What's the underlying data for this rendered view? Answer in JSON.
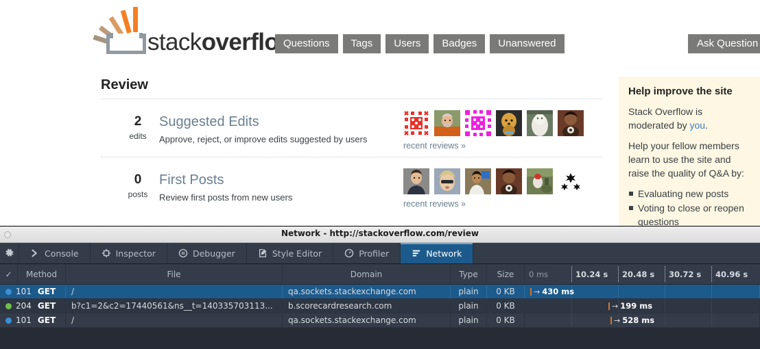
{
  "site": {
    "logo_light": "stack",
    "logo_bold": "overflow",
    "nav": [
      {
        "label": "Questions"
      },
      {
        "label": "Tags"
      },
      {
        "label": "Users"
      },
      {
        "label": "Badges"
      },
      {
        "label": "Unanswered"
      }
    ],
    "ask_button": "Ask Question"
  },
  "main": {
    "page_title": "Review",
    "queues": [
      {
        "count": "2",
        "unit": "edits",
        "title": "Suggested Edits",
        "description": "Approve, reject, or improve edits suggested by users",
        "recent_link": "recent reviews »",
        "avatars": [
          {
            "name": "identicon-red"
          },
          {
            "name": "photo-man-orange-shirt"
          },
          {
            "name": "identicon-magenta"
          },
          {
            "name": "photo-dog-pomeranian"
          },
          {
            "name": "photo-white-animal"
          },
          {
            "name": "photo-man-dark"
          }
        ]
      },
      {
        "count": "0",
        "unit": "posts",
        "title": "First Posts",
        "description": "Review first posts from new users",
        "recent_link": "recent reviews »",
        "avatars": [
          {
            "name": "photo-man-gray-bg"
          },
          {
            "name": "photo-person-sunglasses"
          },
          {
            "name": "photo-man-office"
          },
          {
            "name": "photo-man-dark-bg"
          },
          {
            "name": "photo-outdoor-scene"
          },
          {
            "name": "identicon-stars-black"
          }
        ]
      }
    ]
  },
  "sidebar": {
    "title": "Help improve the site",
    "paragraph1_before": "Stack Overflow is moderated by ",
    "paragraph1_link": "you",
    "paragraph1_after": ".",
    "paragraph2": "Help your fellow members learn to use the site and raise the quality of Q&A by:",
    "bullets": [
      "Evaluating new posts",
      "Voting to close or reopen questions"
    ]
  },
  "devtools": {
    "window_title": "Network - http://stackoverflow.com/review",
    "tabs": [
      {
        "label": "Console",
        "icon": "chevron-right-icon",
        "active": false
      },
      {
        "label": "Inspector",
        "icon": "inspector-box-icon",
        "active": false
      },
      {
        "label": "Debugger",
        "icon": "pause-circle-icon",
        "active": false
      },
      {
        "label": "Style Editor",
        "icon": "style-edit-icon",
        "active": false
      },
      {
        "label": "Profiler",
        "icon": "stopwatch-icon",
        "active": false
      },
      {
        "label": "Network",
        "icon": "network-lines-icon",
        "active": true
      }
    ],
    "settings_icon": "gear-icon",
    "network": {
      "columns": {
        "check": "✓",
        "method": "Method",
        "file": "File",
        "domain": "Domain",
        "type": "Type",
        "size": "Size"
      },
      "timeline_ticks": [
        "0 ms",
        "10.24 s",
        "20.48 s",
        "30.72 s",
        "40.96 s"
      ],
      "rows": [
        {
          "status": "101",
          "status_color": "blue",
          "method": "GET",
          "file": "/",
          "domain": "qa.sockets.stackexchange.com",
          "type": "plain",
          "size": "0 KB",
          "time_label": "430 ms",
          "bar_offset_pct": 2,
          "selected": true
        },
        {
          "status": "204",
          "status_color": "green",
          "method": "GET",
          "file": "b?c1=2&c2=17440561&ns__t=140335703113...",
          "domain": "b.scorecardresearch.com",
          "type": "plain",
          "size": "0 KB",
          "time_label": "199 ms",
          "bar_offset_pct": 36,
          "selected": false
        },
        {
          "status": "101",
          "status_color": "blue",
          "method": "GET",
          "file": "/",
          "domain": "qa.sockets.stackexchange.com",
          "type": "plain",
          "size": "0 KB",
          "time_label": "528 ms",
          "bar_offset_pct": 37,
          "selected": false
        }
      ]
    }
  },
  "colors": {
    "so_orange": "#F48024",
    "nav_gray": "#7A7A78",
    "link_blue": "#6A7E91",
    "sidebar_bg": "#FDF7E3",
    "devtools_bg": "#343C4A",
    "devtools_selected": "#1D5A8C",
    "status_blue": "#3A8FD4",
    "status_green": "#6EC04A",
    "timing_mark": "#D2762E"
  }
}
